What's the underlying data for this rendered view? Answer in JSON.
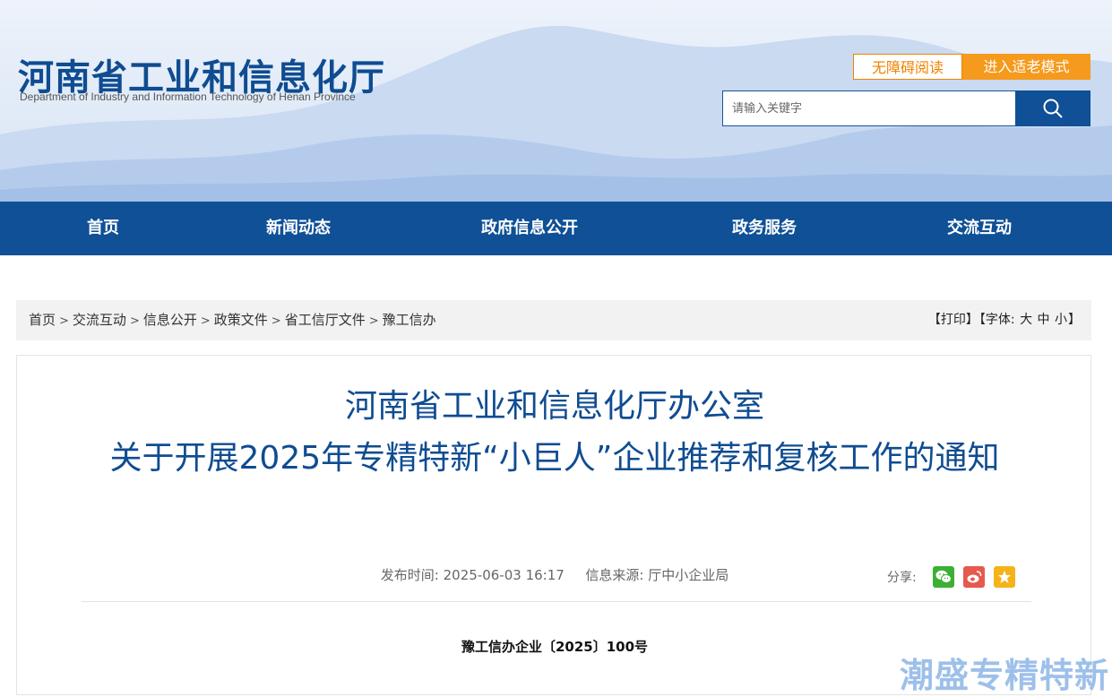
{
  "header": {
    "title": "河南省工业和信息化厅",
    "subtitle": "Department of Industry and Information Technology of Henan Province",
    "accessibility_button": "无障碍阅读",
    "elder_mode_button": "进入适老模式",
    "search": {
      "placeholder": "请输入关键字"
    }
  },
  "nav": {
    "items": [
      {
        "label": "首页"
      },
      {
        "label": "新闻动态"
      },
      {
        "label": "政府信息公开"
      },
      {
        "label": "政务服务"
      },
      {
        "label": "交流互动"
      }
    ]
  },
  "breadcrumb": {
    "items": [
      "首页",
      "交流互动",
      "信息公开",
      "政策文件",
      "省工信厅文件",
      "豫工信办"
    ],
    "separator": ">"
  },
  "tools": {
    "print": "【打印】",
    "font_label": "【字体:",
    "large": "大",
    "medium": "中",
    "small": "小",
    "close": "】"
  },
  "article": {
    "title_line1": "河南省工业和信息化厅办公室",
    "title_line2": "关于开展2025年专精特新“小巨人”企业推荐和复核工作的通知",
    "publish_label": "发布时间:",
    "publish_time": "2025-06-03 16:17",
    "source_label": "信息来源:",
    "source": "厅中小企业局",
    "share_label": "分享:",
    "doc_number": "豫工信办企业〔2025〕100号"
  },
  "watermark": {
    "text": "潮盛专精特新"
  },
  "colors": {
    "brand_blue": "#0f5096",
    "title_blue": "#0f4c91",
    "accent_orange": "#f59a1c",
    "wechat_green": "#3cb034",
    "weibo_red": "#e6594e",
    "favorite_yellow": "#f5b31a"
  }
}
